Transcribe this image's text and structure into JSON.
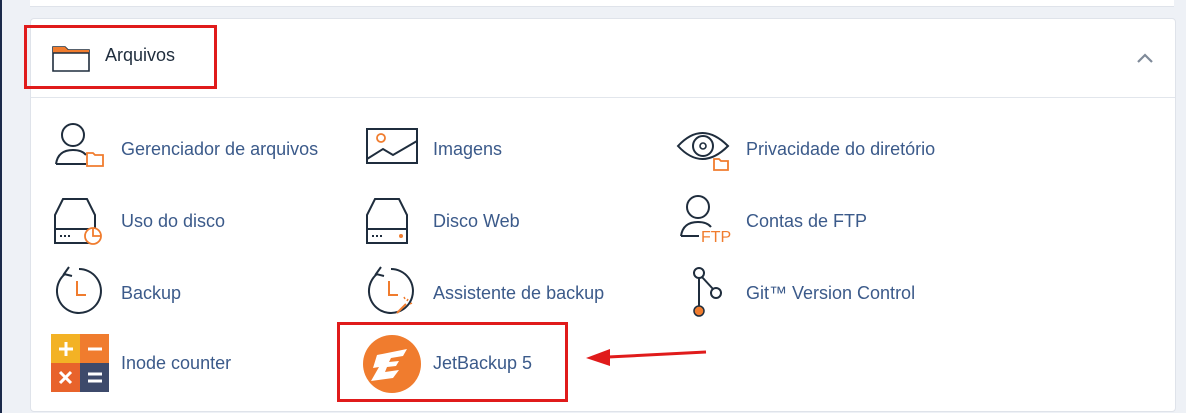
{
  "section": {
    "title": "Arquivos",
    "icon": "folder-icon",
    "collapse_icon": "chevron-up-icon"
  },
  "items": [
    {
      "label": "Gerenciador de arquivos",
      "icon": "file-manager-icon"
    },
    {
      "label": "Imagens",
      "icon": "images-icon"
    },
    {
      "label": "Privacidade do diretório",
      "icon": "directory-privacy-icon"
    },
    {
      "label": "Uso do disco",
      "icon": "disk-usage-icon"
    },
    {
      "label": "Disco Web",
      "icon": "web-disk-icon"
    },
    {
      "label": "Contas de FTP",
      "icon": "ftp-accounts-icon"
    },
    {
      "label": "Backup",
      "icon": "backup-icon"
    },
    {
      "label": "Assistente de backup",
      "icon": "backup-wizard-icon"
    },
    {
      "label": "Git™ Version Control",
      "icon": "git-icon"
    },
    {
      "label": "Inode counter",
      "icon": "inode-counter-icon"
    },
    {
      "label": "JetBackup 5",
      "icon": "jetbackup-icon"
    }
  ],
  "ftp_icon_text": "FTP",
  "colors": {
    "accent": "#f07c2e",
    "link": "#3b5a8a",
    "highlight": "#e01b1b"
  }
}
